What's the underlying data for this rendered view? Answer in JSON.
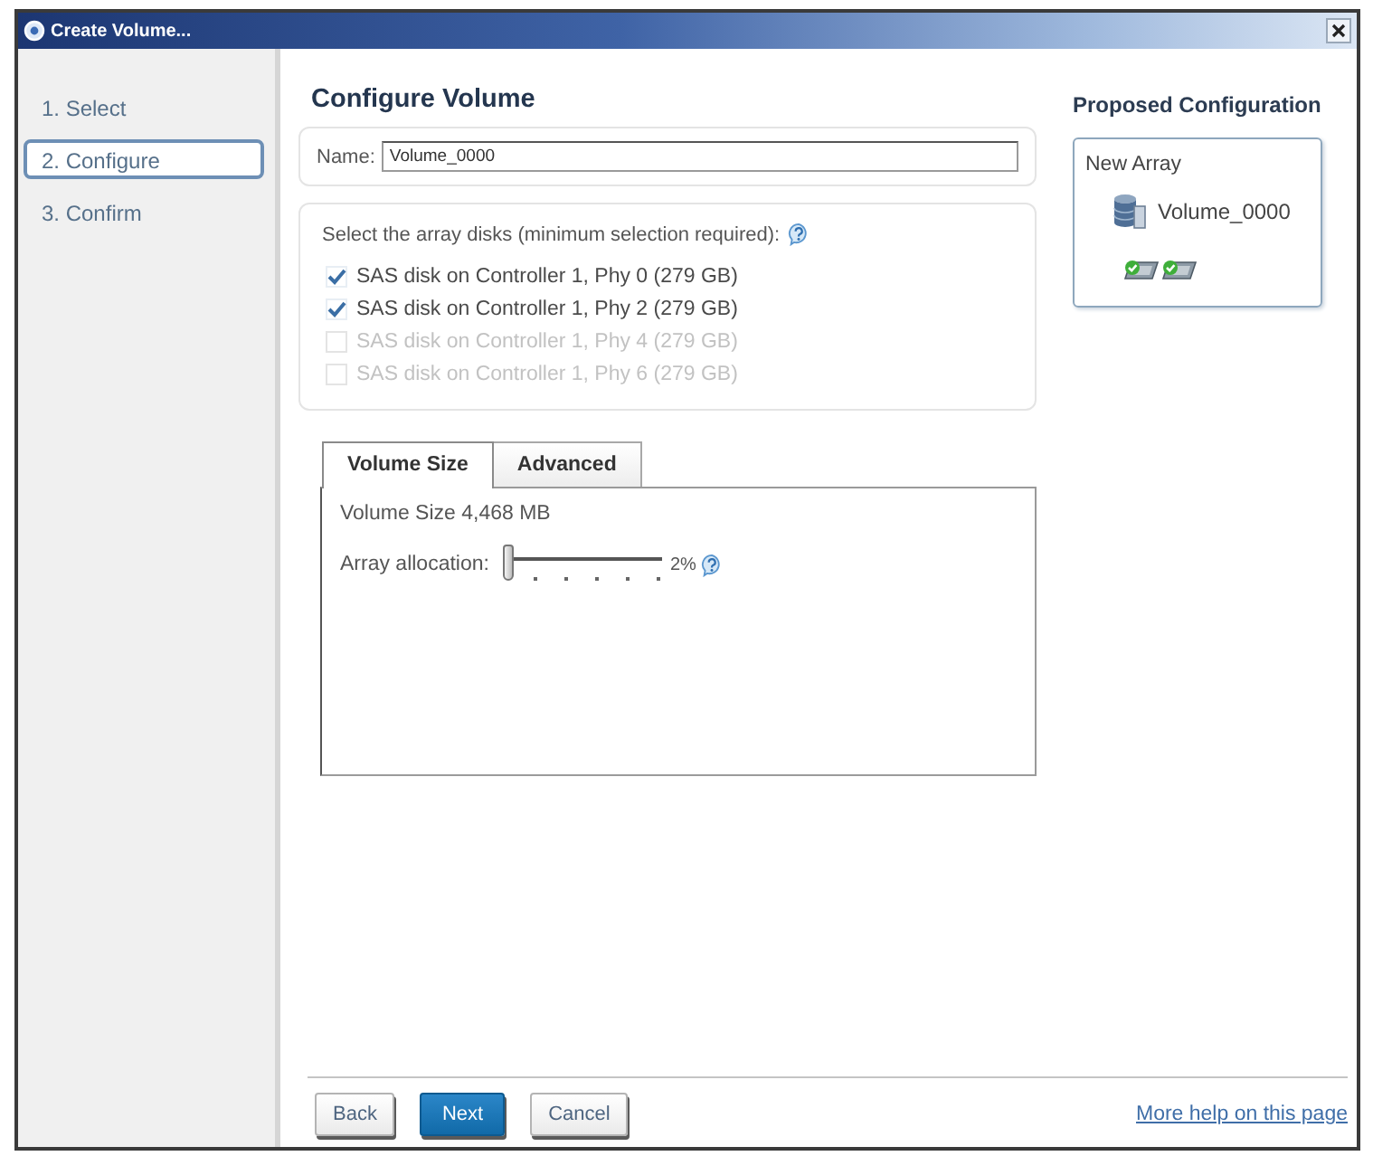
{
  "window": {
    "title": "Create Volume..."
  },
  "steps": [
    {
      "label": "1. Select",
      "selected": false
    },
    {
      "label": "2. Configure",
      "selected": true
    },
    {
      "label": "3. Confirm",
      "selected": false
    }
  ],
  "heading": "Configure Volume",
  "name_field": {
    "label": "Name:",
    "value": "Volume_0000"
  },
  "disks": {
    "prompt": "Select the array disks (minimum selection required):",
    "items": [
      {
        "label": "SAS disk on Controller 1, Phy 0 (279 GB)",
        "checked": true,
        "disabled": false
      },
      {
        "label": "SAS disk on Controller 1, Phy 2 (279 GB)",
        "checked": true,
        "disabled": false
      },
      {
        "label": "SAS disk on Controller 1, Phy 4 (279 GB)",
        "checked": false,
        "disabled": true
      },
      {
        "label": "SAS disk on Controller 1, Phy 6 (279 GB)",
        "checked": false,
        "disabled": true
      }
    ]
  },
  "tabs": [
    {
      "label": "Volume Size",
      "selected": true
    },
    {
      "label": "Advanced",
      "selected": false
    }
  ],
  "volume_size": "Volume Size 4,468 MB",
  "allocation": {
    "label": "Array allocation:",
    "level": 0.02,
    "reading": "2%"
  },
  "buttons": [
    {
      "label": "Back",
      "kind": "default"
    },
    {
      "label": "Next",
      "kind": "primary"
    },
    {
      "label": "Cancel",
      "kind": "default"
    }
  ],
  "help_link": "More help on this page",
  "proposed": {
    "title": "Proposed Configuration",
    "array_label": "New Array",
    "volume": "Volume_0000"
  }
}
